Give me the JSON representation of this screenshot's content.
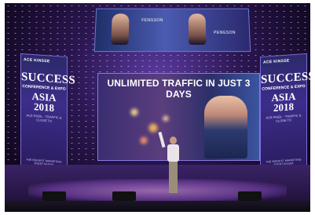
{
  "main_screen": {
    "title": "UNLIMITED TRAFFIC IN JUST 3 DAYS"
  },
  "top_screen": {
    "name_left": "FENGSON",
    "name_right": "PENGSON"
  },
  "banner_left": {
    "brand": "ACE KINSSE",
    "line1": "SUCCESS",
    "line2": "CONFERENCE & EXPO",
    "line3": "ASIA 2018",
    "line4": "ACE PHEIL - TRAFFIC & CLOSE TO",
    "footer": "THE BIGGEST MARKETING EVENT IN ASIA"
  },
  "banner_right": {
    "brand": "ACE KINSSE",
    "line1": "SUCCESS",
    "line2": "CONFERENCE & EXPO",
    "line3": "ASIA 2018",
    "line4": "ACE PHEIL - TRAFFIC & CLOSE TO",
    "footer": "THE BIGGEST MARKETING EVENT IN ASIA"
  }
}
